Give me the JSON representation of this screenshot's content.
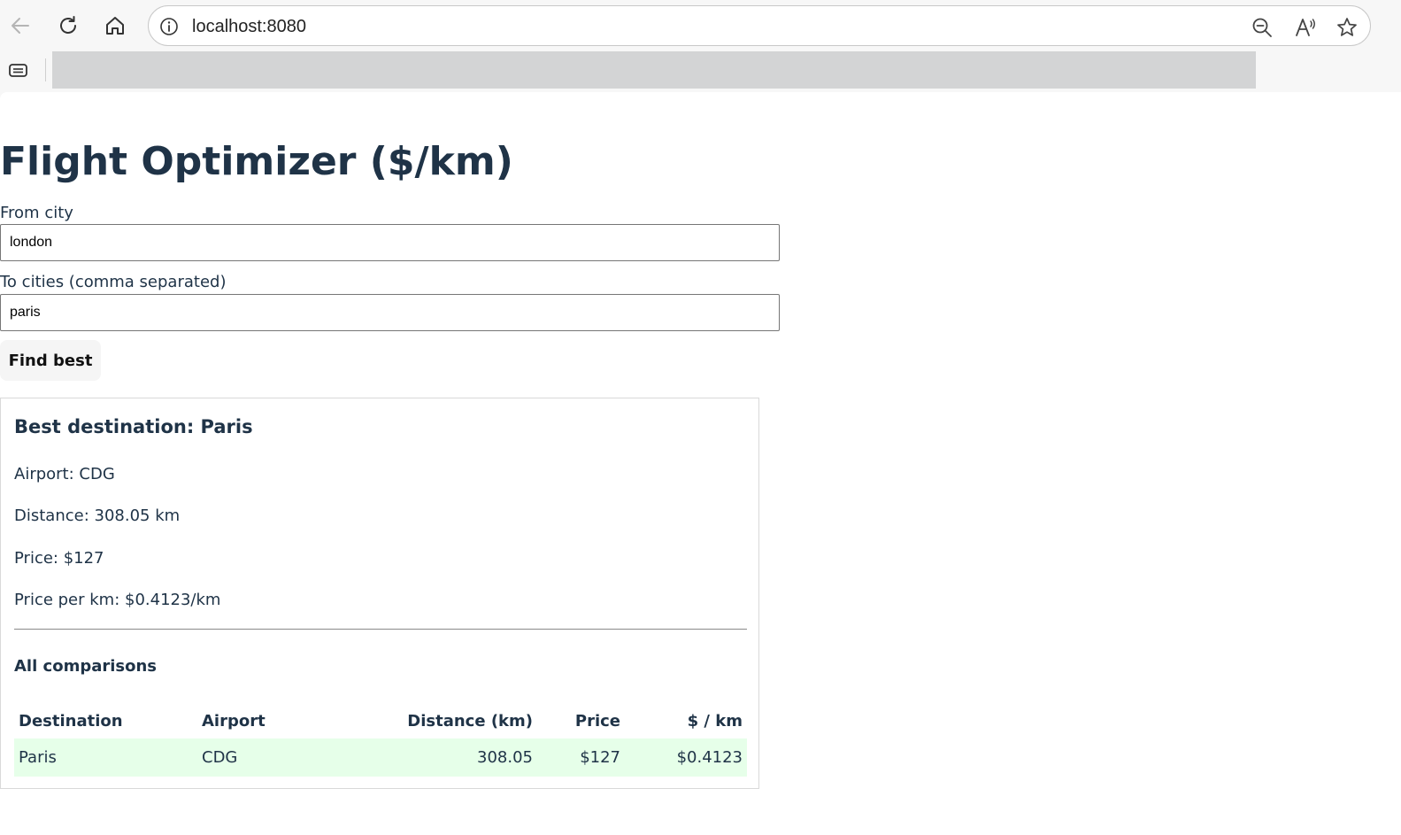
{
  "browser": {
    "url": "localhost:8080",
    "icons": {
      "back": "back-arrow-icon",
      "reload": "reload-icon",
      "home": "home-icon",
      "info": "info-icon",
      "zoom": "zoom-out-icon",
      "read_aloud": "read-aloud-icon",
      "favorite": "star-icon",
      "tab_actions": "tab-actions-icon"
    }
  },
  "page": {
    "title": "Flight Optimizer ($/km)",
    "form": {
      "from_label": "From city",
      "from_value": "london",
      "to_label": "To cities (comma separated)",
      "to_value": "paris",
      "submit_label": "Find best"
    },
    "result": {
      "heading": "Best destination: Paris",
      "airport": "Airport: CDG",
      "distance": "Distance: 308.05 km",
      "price": "Price: $127",
      "price_per_km": "Price per km: $0.4123/km",
      "comparisons_heading": "All comparisons",
      "table": {
        "headers": [
          "Destination",
          "Airport",
          "Distance (km)",
          "Price",
          "$ / km"
        ],
        "rows": [
          [
            "Paris",
            "CDG",
            "308.05",
            "$127",
            "$0.4123"
          ]
        ]
      }
    }
  },
  "colors": {
    "text": "#1f3347",
    "best_row_bg": "#e6ffe9",
    "tab_placeholder": "#d3d4d5"
  }
}
